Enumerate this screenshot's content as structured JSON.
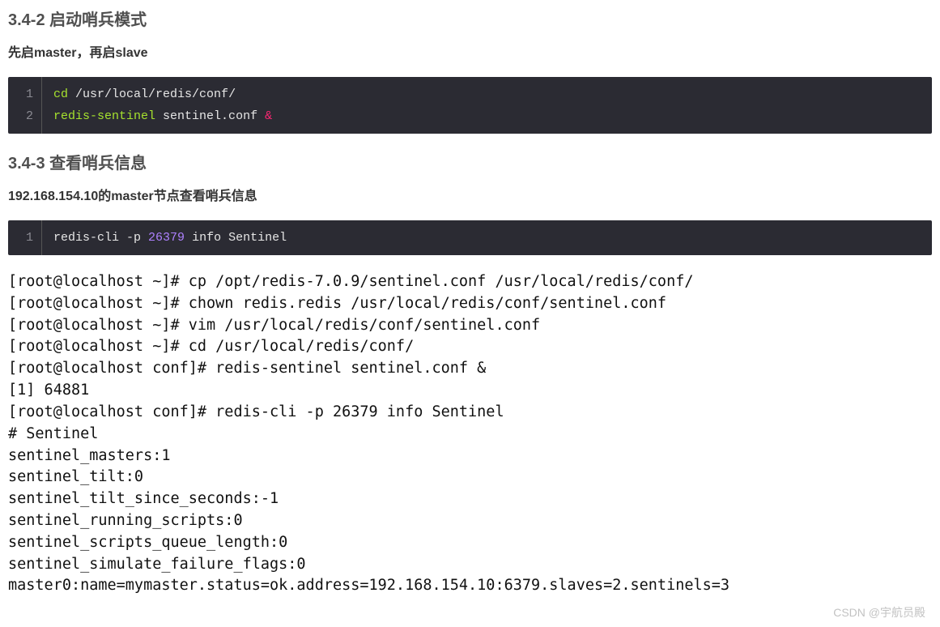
{
  "section1": {
    "heading": "3.4-2 启动哨兵模式",
    "para": "先启master，再启slave"
  },
  "code1": {
    "lineno1": "1",
    "lineno2": "2",
    "l1_cmd": "cd",
    "l1_arg": " /usr/local/redis/conf/",
    "l2_cmd": "redis-sentinel",
    "l2_arg": " sentinel.conf ",
    "l2_op": "&"
  },
  "section2": {
    "heading": "3.4-3 查看哨兵信息",
    "para": "192.168.154.10的master节点查看哨兵信息"
  },
  "code2": {
    "lineno1": "1",
    "l1_a": "redis-cli -p ",
    "l1_num": "26379",
    "l1_b": " info Sentinel"
  },
  "terminal": {
    "lines": [
      "[root@localhost ~]# cp /opt/redis-7.0.9/sentinel.conf /usr/local/redis/conf/",
      "[root@localhost ~]# chown redis.redis /usr/local/redis/conf/sentinel.conf",
      "[root@localhost ~]# vim /usr/local/redis/conf/sentinel.conf",
      "[root@localhost ~]# cd /usr/local/redis/conf/",
      "[root@localhost conf]# redis-sentinel sentinel.conf &",
      "[1] 64881",
      "[root@localhost conf]# redis-cli -p 26379 info Sentinel",
      "# Sentinel",
      "sentinel_masters:1",
      "sentinel_tilt:0",
      "sentinel_tilt_since_seconds:-1",
      "sentinel_running_scripts:0",
      "sentinel_scripts_queue_length:0",
      "sentinel_simulate_failure_flags:0",
      "master0:name=mymaster.status=ok.address=192.168.154.10:6379.slaves=2.sentinels=3"
    ]
  },
  "watermark": "CSDN @宇航员殿"
}
